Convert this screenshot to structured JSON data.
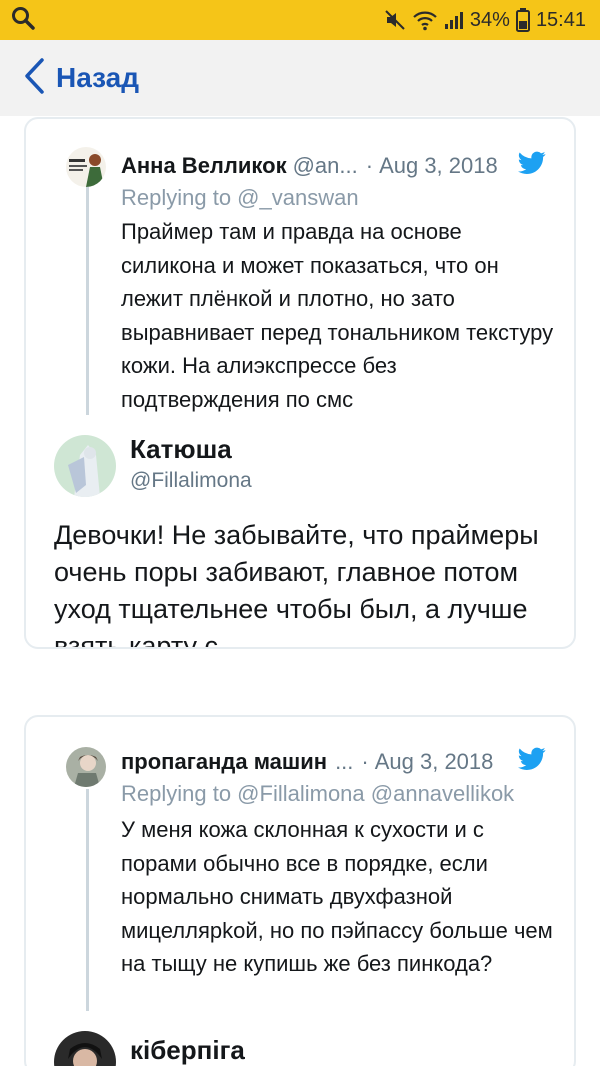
{
  "status_bar": {
    "battery": "34%",
    "time": "15:41",
    "icons": [
      "search-icon",
      "mute-icon",
      "wifi-icon",
      "signal-icon",
      "battery-icon"
    ]
  },
  "nav": {
    "back_label": "Назад"
  },
  "colors": {
    "status_bg": "#f5c518",
    "link": "#1a56b5",
    "twitter": "#1da1f2"
  },
  "card1": {
    "reply": {
      "name": "Анна Велликок",
      "handle": "@an...",
      "separator": "·",
      "date": "Aug 3, 2018",
      "replying": "Replying to @_vanswan",
      "text": "Праймер там и правда на основе силикона и может показаться, что он лежит плёнкой и плотно, но зато выравнивает перед тональником текстуру кожи. На алиэкспрессе без подтверждения по смс"
    },
    "main": {
      "name": "Катюша",
      "handle": "@Fillalimona",
      "text": "Девочки! Не забывайте, что праймеры очень поры забивают, главное потом уход тщательнее чтобы был, а лучше взять карту с"
    }
  },
  "card2": {
    "reply": {
      "name": "пропаганда машин",
      "ellipsis": "...",
      "separator": "·",
      "date": "Aug 3, 2018",
      "replying": "Replying to @Fillalimona @annavellikok",
      "text": "У меня кожа склонная к сухости и с порами обычно все в порядке, если нормально снимать двухфазной мицеллярkой, но по пэйпассу больше чем на тыщу не купишь же без пинкода?"
    },
    "main": {
      "name": "кіберпіга"
    }
  }
}
